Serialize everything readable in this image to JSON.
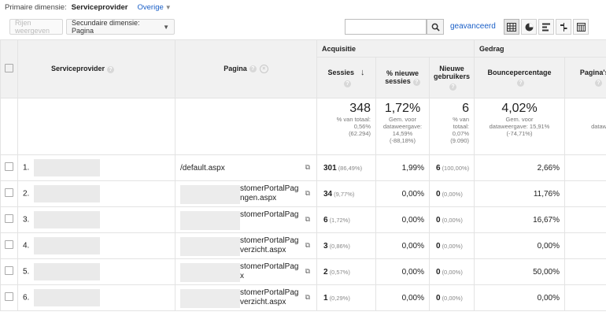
{
  "dim_bar": {
    "label": "Primaire dimensie:",
    "active": "Serviceprovider",
    "other": "Overige"
  },
  "toolbar": {
    "rows_button": "Rijen weergeven",
    "secondary_dim": "Secundaire dimensie: Pagina",
    "advanced": "geavanceerd"
  },
  "table": {
    "groups": {
      "acq": "Acquisitie",
      "beh": "Gedrag"
    },
    "headers": {
      "provider": "Serviceprovider",
      "page": "Pagina",
      "sessions": "Sessies",
      "new_sessions": "% nieuwe sessies",
      "new_users": "Nieuwe gebruikers",
      "bounce": "Bouncepercentage",
      "pages_per": "Pagina's/s"
    },
    "totals": {
      "sessions": "348",
      "sessions_sub": [
        "% van totaal:",
        "0,56%",
        "(62.294)"
      ],
      "new_sessions": "1,72%",
      "new_sessions_sub": [
        "Gem. voor",
        "dataweergave:",
        "14,59%",
        "(-88,18%)"
      ],
      "new_users": "6",
      "new_users_sub": [
        "% van",
        "totaal:",
        "0,07%",
        "(9.090)"
      ],
      "bounce": "4,02%",
      "bounce_sub": [
        "Gem. voor",
        "dataweergave: 15,91%",
        "(-74,71%)"
      ],
      "pages_sub": [
        "Ge",
        "dataweergav",
        "("
      ]
    },
    "rows": [
      {
        "idx": "1.",
        "page_l1": "/default.aspx",
        "page_l2": "",
        "sessions": "301",
        "sessions_pct": "(86,49%)",
        "new_sess": "1,99%",
        "new_users": "6",
        "new_users_pct": "(100,00%)",
        "bounce": "2,66%"
      },
      {
        "idx": "2.",
        "page_l1": "stomerPortalPag",
        "page_l2": "ngen.aspx",
        "sessions": "34",
        "sessions_pct": "(9,77%)",
        "new_sess": "0,00%",
        "new_users": "0",
        "new_users_pct": "(0,00%)",
        "bounce": "11,76%"
      },
      {
        "idx": "3.",
        "page_l1": "stomerPortalPag",
        "page_l2": "",
        "sessions": "6",
        "sessions_pct": "(1,72%)",
        "new_sess": "0,00%",
        "new_users": "0",
        "new_users_pct": "(0,00%)",
        "bounce": "16,67%"
      },
      {
        "idx": "4.",
        "page_l1": "stomerPortalPag",
        "page_l2": "verzicht.aspx",
        "sessions": "3",
        "sessions_pct": "(0,86%)",
        "new_sess": "0,00%",
        "new_users": "0",
        "new_users_pct": "(0,00%)",
        "bounce": "0,00%"
      },
      {
        "idx": "5.",
        "page_l1": "stomerPortalPag",
        "page_l2": "x",
        "sessions": "2",
        "sessions_pct": "(0,57%)",
        "new_sess": "0,00%",
        "new_users": "0",
        "new_users_pct": "(0,00%)",
        "bounce": "50,00%"
      },
      {
        "idx": "6.",
        "page_l1": "stomerPortalPag",
        "page_l2": "verzicht.aspx",
        "sessions": "1",
        "sessions_pct": "(0,29%)",
        "new_sess": "0,00%",
        "new_users": "0",
        "new_users_pct": "(0,00%)",
        "bounce": "0,00%"
      }
    ]
  }
}
